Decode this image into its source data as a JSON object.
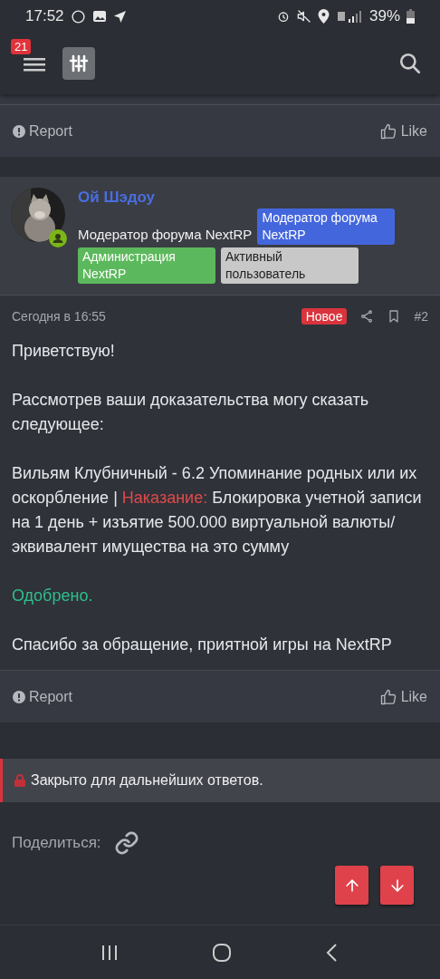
{
  "status_bar": {
    "time": "17:52",
    "battery": "39%"
  },
  "header": {
    "notification_count": "21"
  },
  "previous_post_footer": {
    "report": "Report",
    "like": "Like"
  },
  "post": {
    "author": "Ой Шэдоу",
    "author_title": "Модератор форума NextRP",
    "badges": [
      {
        "text": "Модератор форума NextRP",
        "color": "#4466dd"
      },
      {
        "text": "Администрация NextRP",
        "color": "#5cb85c"
      },
      {
        "text": "Активный пользователь",
        "color": "#c8c8c8"
      }
    ],
    "date": "Сегодня в 16:55",
    "new_label": "Новое",
    "number": "#2",
    "paragraphs": [
      [
        {
          "kind": "plain",
          "text": "Приветствую!"
        }
      ],
      [
        {
          "kind": "plain",
          "text": "Рассмотрев ваши доказательства могу сказать следующее:"
        }
      ],
      [
        {
          "kind": "plain",
          "text": "Вильям Клубничный - 6.2 Упоминание родных или их оскорбление | "
        },
        {
          "kind": "penalty",
          "text": "Наказание:"
        },
        {
          "kind": "plain",
          "text": " Блокировка учетной записи на 1 день + изъятие 500.000 виртуальной валюты/эквивалент имущества на это сумму"
        }
      ],
      [
        {
          "kind": "approved",
          "text": "Одобрено."
        }
      ],
      [
        {
          "kind": "plain",
          "text": "Спасибо за обращение, приятной игры на NextRP"
        }
      ]
    ],
    "report": "Report",
    "like": "Like"
  },
  "closed_notice": "Закрыто для дальнейших ответов.",
  "share_label": "Поделиться:"
}
